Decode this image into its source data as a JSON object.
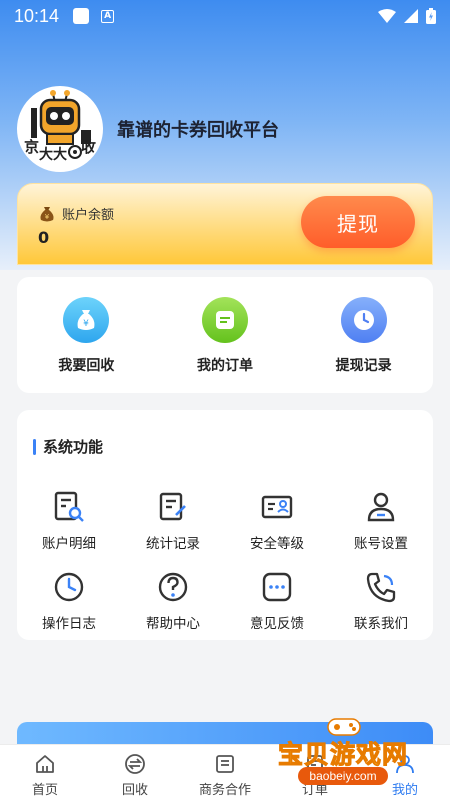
{
  "status_bar": {
    "time": "10:14",
    "notif_letter": "A"
  },
  "profile": {
    "avatar_text_left": "京",
    "avatar_text_bottom": "大大",
    "avatar_text_right": "收",
    "platform_title": "靠谱的卡券回收平台"
  },
  "balance": {
    "label": "账户余额",
    "value": "0",
    "withdraw_label": "提现"
  },
  "quick_actions": [
    {
      "label": "我要回收",
      "icon": "money-bag-icon",
      "color": "#3db4f2"
    },
    {
      "label": "我的订单",
      "icon": "order-icon",
      "color": "#7ed32a"
    },
    {
      "label": "提现记录",
      "icon": "clock-icon",
      "color": "#5b8ef7"
    }
  ],
  "system": {
    "title": "系统功能",
    "items": [
      {
        "label": "账户明细",
        "icon": "account-detail-icon"
      },
      {
        "label": "统计记录",
        "icon": "statistics-icon"
      },
      {
        "label": "安全等级",
        "icon": "security-level-icon"
      },
      {
        "label": "账号设置",
        "icon": "account-settings-icon"
      },
      {
        "label": "操作日志",
        "icon": "clock-icon"
      },
      {
        "label": "帮助中心",
        "icon": "help-icon"
      },
      {
        "label": "意见反馈",
        "icon": "feedback-icon"
      },
      {
        "label": "联系我们",
        "icon": "phone-icon"
      }
    ]
  },
  "tabs": [
    {
      "label": "首页",
      "icon": "home-icon"
    },
    {
      "label": "回收",
      "icon": "recycle-icon"
    },
    {
      "label": "商务合作",
      "icon": "business-icon"
    },
    {
      "label": "订单",
      "icon": "order-icon"
    },
    {
      "label": "我的",
      "icon": "user-icon",
      "active": true
    }
  ],
  "watermark": {
    "text": "宝贝游戏网",
    "url": "baobeiy.com"
  },
  "colors": {
    "accent": "#2f7cf0",
    "withdraw": "#ff6a35",
    "balance_card": "#ffd977"
  }
}
